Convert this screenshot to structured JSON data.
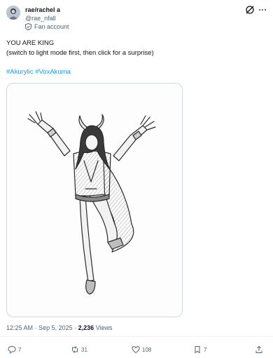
{
  "author": {
    "name": "rae/rachel a",
    "handle": "@rae_nfall",
    "badge_label": "Fan account"
  },
  "post": {
    "line1": "YOU ARE KING",
    "line2": "(switch to light mode first, then click for a surprise)",
    "hashtags": [
      "#Akurylic",
      "#VoxAkuma"
    ]
  },
  "meta": {
    "time": "12:25 AM",
    "sep1": "·",
    "date": "Sep 5, 2025",
    "sep2": "·",
    "views_count": "2,236",
    "views_label": "Views"
  },
  "actions": {
    "replies": "7",
    "reposts": "31",
    "likes": "108",
    "bookmarks": "7"
  },
  "colors": {
    "accent": "#1d9bf0",
    "secondary_text": "#536471",
    "divider": "#eff3f4"
  },
  "icons": [
    "grok-icon",
    "more-icon",
    "reply-icon",
    "repost-icon",
    "like-icon",
    "bookmark-icon",
    "share-icon"
  ]
}
